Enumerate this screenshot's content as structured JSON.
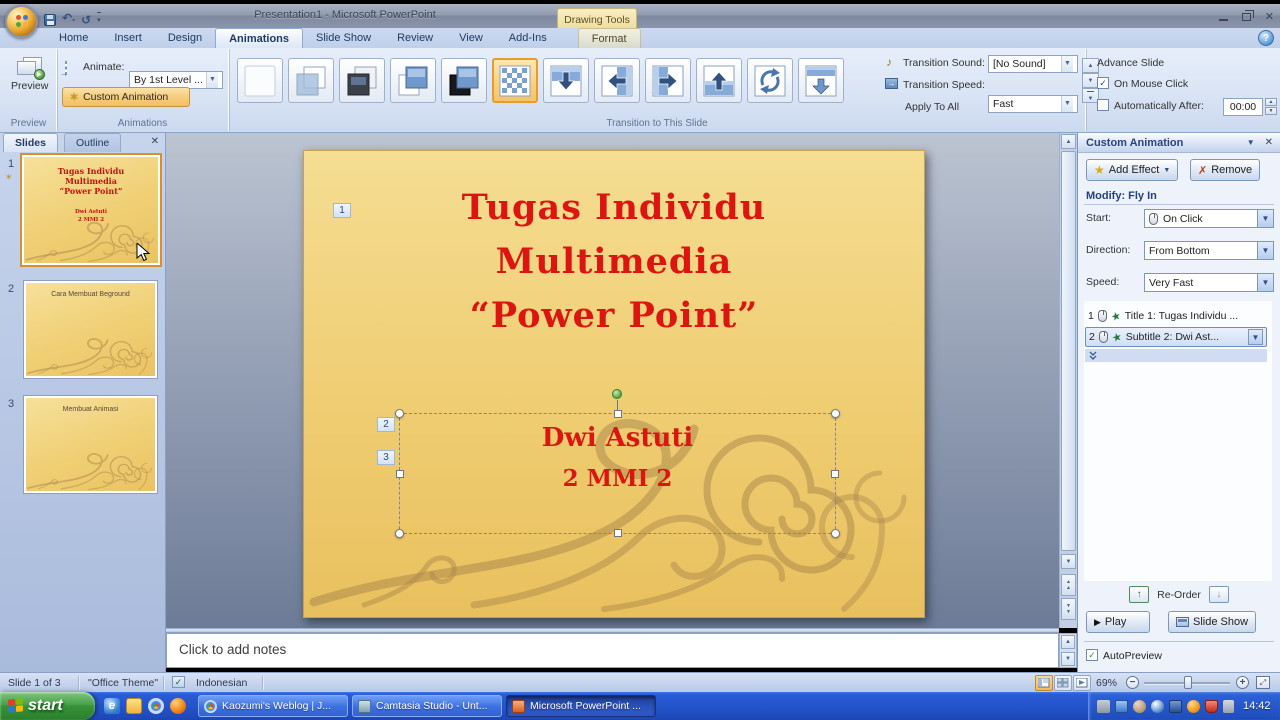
{
  "window": {
    "title": "Presentation1 - Microsoft PowerPoint",
    "contextual_group": "Drawing Tools"
  },
  "tabs": [
    {
      "label": "Home"
    },
    {
      "label": "Insert"
    },
    {
      "label": "Design"
    },
    {
      "label": "Animations"
    },
    {
      "label": "Slide Show"
    },
    {
      "label": "Review"
    },
    {
      "label": "View"
    },
    {
      "label": "Add-Ins"
    }
  ],
  "contextual_tab": {
    "label": "Format"
  },
  "ribbon": {
    "preview": {
      "button": "Preview",
      "group_label": "Preview"
    },
    "animations": {
      "animate_label": "Animate:",
      "animate_value": "By 1st Level ...",
      "custom_animation": "Custom Animation",
      "group_label": "Animations"
    },
    "transition": {
      "group_label": "Transition to This Slide",
      "sound_label": "Transition Sound:",
      "sound_value": "[No Sound]",
      "speed_label": "Transition Speed:",
      "speed_value": "Fast",
      "apply_to_all": "Apply To All",
      "gallery_items": [
        "No Transition",
        "Fade Smoothly",
        "Fade Through Black",
        "Cut",
        "Cut Through Black",
        "Dissolve",
        "Wipe Down",
        "Wipe Left",
        "Wipe Right",
        "Wipe Up",
        "Wedge",
        "Push Down"
      ],
      "selected_index": 5
    },
    "advance": {
      "label": "Advance Slide",
      "on_mouse_click": "On Mouse Click",
      "automatically_after": "Automatically After:",
      "after_value": "00:00"
    }
  },
  "slides_panel": {
    "slides_tab": "Slides",
    "outline_tab": "Outline",
    "slides": [
      {
        "number": "1"
      },
      {
        "number": "2",
        "title": "Cara Membuat Beground"
      },
      {
        "number": "3",
        "title": "Membuat Animasi"
      }
    ]
  },
  "slide": {
    "title_lines": [
      "Tugas Individu",
      "Multimedia",
      "“Power Point”"
    ],
    "subtitle_lines": [
      "Dwi Astuti",
      "2 MMI 2"
    ],
    "animation_tags": [
      "1",
      "2",
      "3"
    ]
  },
  "notes": {
    "placeholder": "Click to add notes"
  },
  "task_pane": {
    "title": "Custom Animation",
    "add_effect": "Add Effect",
    "remove": "Remove",
    "modify": "Modify: Fly In",
    "start_label": "Start:",
    "start_value": "On Click",
    "direction_label": "Direction:",
    "direction_value": "From Bottom",
    "speed_label": "Speed:",
    "speed_value": "Very Fast",
    "items": [
      {
        "order": "1",
        "label": "Title 1: Tugas Individu ..."
      },
      {
        "order": "2",
        "label": "Subtitle 2: Dwi Ast..."
      }
    ],
    "reorder": "Re-Order",
    "play": "Play",
    "slide_show": "Slide Show",
    "autopreview": "AutoPreview"
  },
  "status_bar": {
    "slide_info": "Slide 1 of 3",
    "theme": "\"Office Theme\"",
    "language": "Indonesian",
    "zoom": "69%"
  },
  "taskbar": {
    "start": "start",
    "tasks": [
      {
        "label": "Kaozumi's Weblog | J..."
      },
      {
        "label": "Camtasia Studio - Unt..."
      },
      {
        "label": "Microsoft PowerPoint ..."
      }
    ],
    "clock": "14:42"
  }
}
